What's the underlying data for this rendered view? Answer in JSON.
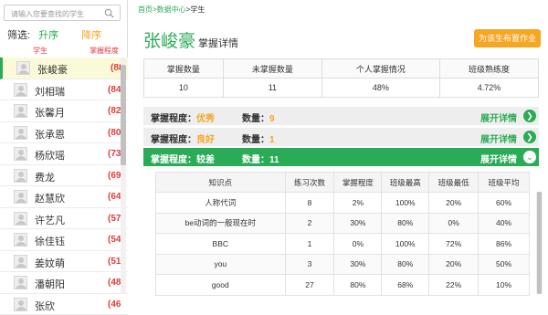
{
  "sidebar": {
    "search_placeholder": "请输入您要查找的学生",
    "filter_label": "筛选:",
    "sort_asc": "升序",
    "sort_desc": "降序",
    "col_student": "学生",
    "col_mastery": "掌握程度",
    "students": [
      {
        "name": "张峻豪",
        "score": "(88"
      },
      {
        "name": "刘相瑞",
        "score": "(84"
      },
      {
        "name": "张馨月",
        "score": "(82"
      },
      {
        "name": "张承恩",
        "score": "(80"
      },
      {
        "name": "杨欣瑶",
        "score": "(73"
      },
      {
        "name": "费龙",
        "score": "(69"
      },
      {
        "name": "赵慧欣",
        "score": "(64"
      },
      {
        "name": "许艺凡",
        "score": "(57"
      },
      {
        "name": "徐佳钰",
        "score": "(54"
      },
      {
        "name": "姜妏萌",
        "score": "(51"
      },
      {
        "name": "潘朝阳",
        "score": "(48"
      },
      {
        "name": "张欣",
        "score": "(46"
      }
    ]
  },
  "breadcrumb": {
    "home": "首页",
    "sep1": ">",
    "center": "数据中心",
    "sep2": ">",
    "current": "学生"
  },
  "header": {
    "student_name": "张峻豪",
    "subtitle": "掌握详情",
    "assign_button": "为该生布置作业"
  },
  "stats": {
    "headers": [
      "掌握数量",
      "未掌握数量",
      "个人掌握情况",
      "班级熟练度"
    ],
    "values": [
      "10",
      "11",
      "48%",
      "4.72%"
    ]
  },
  "groups": [
    {
      "prefix": "掌握程度：",
      "level": "优秀",
      "count_label": "数量：",
      "count": "9",
      "expand": "展开详情",
      "icon": "chevron-right"
    },
    {
      "prefix": "掌握程度：",
      "level": "良好",
      "count_label": "数量：",
      "count": "1",
      "expand": "展开详情",
      "icon": "chevron-right"
    },
    {
      "prefix": "掌握程度：",
      "level": "较差",
      "count_label": "数量：",
      "count": "11",
      "expand": "展开详情",
      "icon": "chevron-down"
    }
  ],
  "detail": {
    "headers": [
      "知识点",
      "练习次数",
      "掌握程度",
      "班级最高",
      "班级最低",
      "班级平均"
    ],
    "rows": [
      [
        "人称代词",
        "8",
        "2%",
        "100%",
        "20%",
        "60%"
      ],
      [
        "be动词的一般现在时",
        "2",
        "30%",
        "80%",
        "0%",
        "40%"
      ],
      [
        "BBC",
        "1",
        "0%",
        "100%",
        "72%",
        "86%"
      ],
      [
        "you",
        "3",
        "30%",
        "80%",
        "20%",
        "50%"
      ],
      [
        "good",
        "27",
        "80%",
        "68%",
        "22%",
        "10%"
      ]
    ]
  }
}
